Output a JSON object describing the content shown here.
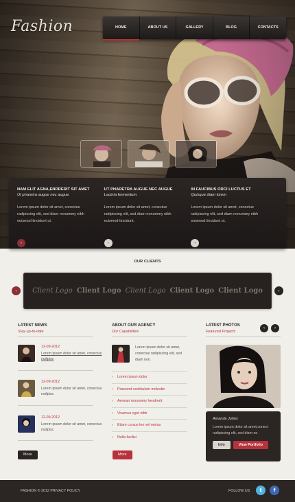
{
  "brand": {
    "logo": "Fashion"
  },
  "nav": [
    {
      "label": "HOME",
      "active": true
    },
    {
      "label": "ABOUT US"
    },
    {
      "label": "GALLERY"
    },
    {
      "label": "BLOG"
    },
    {
      "label": "CONTACTS"
    }
  ],
  "features": [
    {
      "title": "NAM ELIT AGNA,ENDRERIT SIT AMET",
      "subtitle": "Ut pharetra augue nec augue",
      "text": "Lorem ipsum dolor sit amet, conectue radipiscing elit, sed diam nonummy nibh euismod tincidunt ut.",
      "button_icon": "chevron-left-icon"
    },
    {
      "title": "UT PHARETRA AUGUE NEC AUGUE",
      "subtitle": "Lacinia fermentum",
      "text": "Lorem ipsum dolor sit amet, conectue radipiscing elit, sed diam nonummy nibh euismod tincidunt.",
      "button_icon": "chevron-right-icon"
    },
    {
      "title": "IN FAUCIBUS ORCI LUCTUS ET",
      "subtitle": "Quisque diam lorem",
      "text": "Lorem ipsum dolor sit amet, conectue radipiscing elit, sed diam nonummy nibh euismod tincidunt ut.",
      "button_icon": "chevron-right-icon"
    }
  ],
  "clients": {
    "title": "OUR CLIENTS",
    "logos": [
      "Client Logo",
      "Client Logo",
      "Client Logo",
      "Client Logo",
      "Client Logo"
    ]
  },
  "news": {
    "title": "LATEST NEWS",
    "subtitle": "Stay up-to-date",
    "items": [
      {
        "date": "12-09-2012",
        "text_link": "Lorem ipsum dolor sit amet, conectue radipisc",
        "text": ""
      },
      {
        "date": "12-09-2012",
        "text_link": "",
        "text": "Lorem ipsum dolor sit amet, conectue radipisc"
      },
      {
        "date": "12-09-2012",
        "text_link": "",
        "text": "Lorem ipsum dolor sit amet, conectue radipisc"
      }
    ],
    "more": "More"
  },
  "agency": {
    "title": "ABOUT OUR AGENCY",
    "subtitle": "Our Capabilities",
    "intro": "Lorem ipsum dolor sit amet, conectue radipiscing elit, sed diam non.",
    "capabilities": [
      "Lorem ipsum dolor",
      "Praesent vestibulum molestie",
      "Aenean nonummy hendrerit",
      "Vivamus eget nibh",
      "Etiam cursus leo vel metus",
      "Nulla facilisi"
    ],
    "more": "More"
  },
  "photos": {
    "title": "LATEST PHOTOS",
    "subtitle": "Featured Projects",
    "name": "Amanda Johns",
    "text": "Lorem ipsum dolor sit amet,conect radipiscing elit, sed diam no",
    "info_btn": "Info",
    "portfolio_btn": "View Portfolio"
  },
  "footer": {
    "copyright": "FASHION © 2012 PRIVACY POLICY",
    "follow": "FOLLOW US",
    "twitter": "t",
    "facebook": "f"
  },
  "colors": {
    "accent": "#b7323b",
    "dark": "#2b2523",
    "background": "#f0efea"
  }
}
